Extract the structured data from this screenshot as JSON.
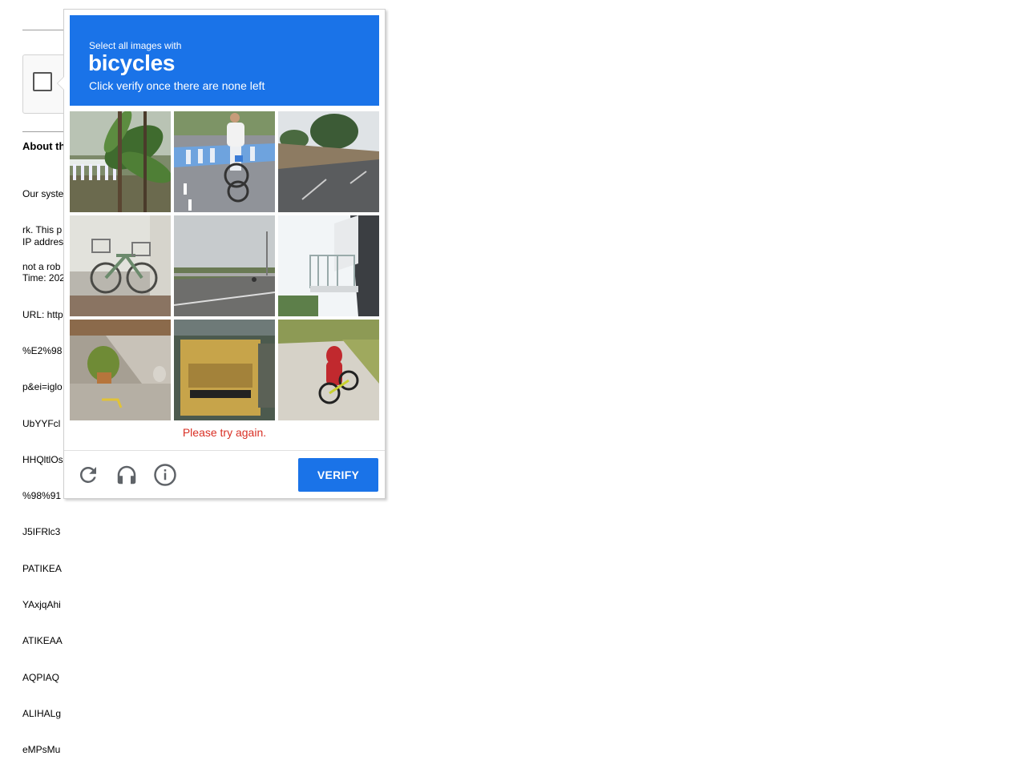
{
  "background_page": {
    "about_heading": "About th",
    "paragraph_lines": [
      "Our syste",
      "rk. This p",
      "not a rob"
    ],
    "info_lines": [
      "IP addres",
      "Time: 202",
      "URL: http",
      "%E2%98",
      "p&ei=iglo",
      "UbYYFcl",
      "HHQltlOs",
      "%98%91",
      "J5IFRlc3",
      "PATIKEA",
      "YAxjqAhi",
      "ATIKEAA",
      "AQPIAQ",
      "ALIHALg",
      "eMPsMu"
    ]
  },
  "captcha": {
    "instruction_small": "Select all images with",
    "target_object": "bicycles",
    "instruction_sub": "Click verify once there are none left",
    "tiles": [
      {
        "id": "tile-1",
        "depicts": "banana plants and railing",
        "selected": false
      },
      {
        "id": "tile-2",
        "depicts": "cyclist on crosswalk",
        "selected": false
      },
      {
        "id": "tile-3",
        "depicts": "road with trees",
        "selected": false
      },
      {
        "id": "tile-4",
        "depicts": "parked bicycles",
        "selected": false
      },
      {
        "id": "tile-5",
        "depicts": "open road with distant cyclist",
        "selected": false
      },
      {
        "id": "tile-6",
        "depicts": "building balcony",
        "selected": false
      },
      {
        "id": "tile-7",
        "depicts": "ramp with potted plant",
        "selected": false
      },
      {
        "id": "tile-8",
        "depicts": "yellow truck",
        "selected": false
      },
      {
        "id": "tile-9",
        "depicts": "cyclist in red on path",
        "selected": false
      }
    ],
    "error_message": "Please try again.",
    "verify_label": "VERIFY",
    "icons": {
      "reload": "reload-icon",
      "audio": "headphones-icon",
      "info": "info-icon"
    }
  },
  "colors": {
    "accent": "#1a73e8",
    "error": "#d93025"
  }
}
